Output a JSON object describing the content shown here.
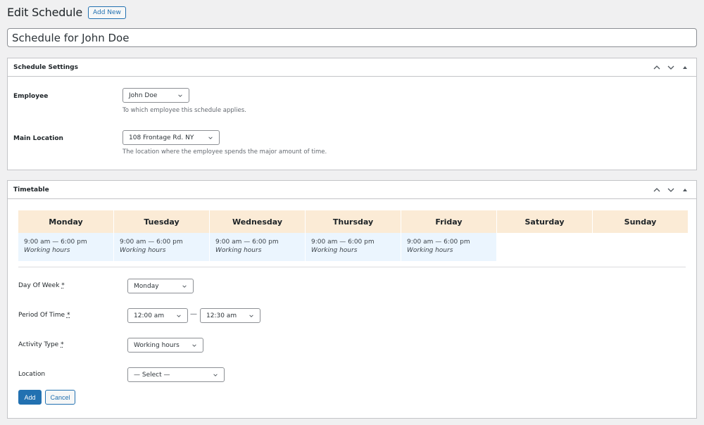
{
  "header": {
    "title": "Edit Schedule",
    "add_new_label": "Add New"
  },
  "title_input": {
    "value": "Schedule for John Doe"
  },
  "schedule_settings": {
    "title": "Schedule Settings",
    "employee": {
      "label": "Employee",
      "value": "John Doe",
      "description": "To which employee this schedule applies."
    },
    "main_location": {
      "label": "Main Location",
      "value": "108 Frontage Rd. NY",
      "description": "The location where the employee spends the major amount of time."
    }
  },
  "timetable": {
    "title": "Timetable",
    "days": [
      {
        "name": "Monday",
        "time": "9:00 am — 6:00 pm",
        "activity": "Working hours"
      },
      {
        "name": "Tuesday",
        "time": "9:00 am — 6:00 pm",
        "activity": "Working hours"
      },
      {
        "name": "Wednesday",
        "time": "9:00 am — 6:00 pm",
        "activity": "Working hours"
      },
      {
        "name": "Thursday",
        "time": "9:00 am — 6:00 pm",
        "activity": "Working hours"
      },
      {
        "name": "Friday",
        "time": "9:00 am — 6:00 pm",
        "activity": "Working hours"
      },
      {
        "name": "Saturday",
        "time": "",
        "activity": ""
      },
      {
        "name": "Sunday",
        "time": "",
        "activity": ""
      }
    ],
    "form": {
      "day_of_week": {
        "label": "Day Of Week",
        "required_mark": "*",
        "value": "Monday"
      },
      "period": {
        "label": "Period Of Time",
        "required_mark": "*",
        "from": "12:00 am",
        "separator": "—",
        "to": "12:30 am"
      },
      "activity_type": {
        "label": "Activity Type",
        "required_mark": "*",
        "value": "Working hours"
      },
      "location": {
        "label": "Location",
        "value": "— Select —"
      },
      "add_label": "Add",
      "cancel_label": "Cancel"
    }
  },
  "colors": {
    "accent": "#2271b1",
    "day_header_bg": "#fbebd6",
    "filled_cell_bg": "#ebf5fe",
    "page_bg": "#f0f0f1"
  }
}
